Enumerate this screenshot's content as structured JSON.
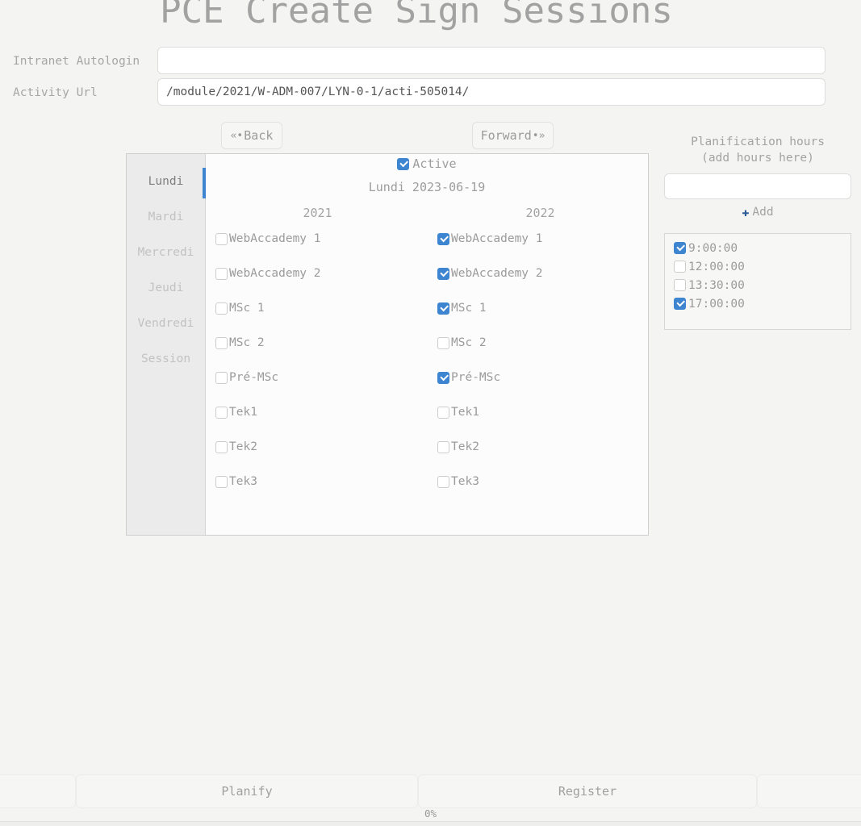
{
  "header": {
    "title": "PCE Create Sign Sessions"
  },
  "form": {
    "fields": [
      {
        "label": "Intranet Autologin",
        "value": "",
        "placeholder": ""
      },
      {
        "label": "Activity Url",
        "value": "/module/2021/W-ADM-007/LYN-0-1/acti-505014/",
        "placeholder": ""
      }
    ]
  },
  "nav": {
    "back_label": "Back",
    "back_icon": "rewind-icon",
    "back_glyph": "«•",
    "forward_label": "Forward",
    "forward_icon": "fast-forward-icon",
    "forward_glyph": "•»"
  },
  "tabs": {
    "items": [
      {
        "label": "Lundi",
        "active": true
      },
      {
        "label": "Mardi",
        "active": false
      },
      {
        "label": "Mercredi",
        "active": false
      },
      {
        "label": "Jeudi",
        "active": false
      },
      {
        "label": "Vendredi",
        "active": false
      },
      {
        "label": "Session",
        "active": false
      }
    ],
    "active_indicator_color": "#3d85d0"
  },
  "panel": {
    "active_checkbox": {
      "label": "Active",
      "checked": true
    },
    "date_label": "Lundi 2023-06-19",
    "columns": [
      {
        "header": "2021"
      },
      {
        "header": "2022"
      }
    ],
    "rows": [
      {
        "col1": {
          "label": "WebAccademy 1",
          "checked": false
        },
        "col2": {
          "label": "WebAccademy 1",
          "checked": true
        }
      },
      {
        "col1": {
          "label": "WebAccademy 2",
          "checked": false
        },
        "col2": {
          "label": "WebAccademy 2",
          "checked": true
        }
      },
      {
        "col1": {
          "label": "MSc 1",
          "checked": false
        },
        "col2": {
          "label": "MSc 1",
          "checked": true
        }
      },
      {
        "col1": {
          "label": "MSc 2",
          "checked": false
        },
        "col2": {
          "label": "MSc 2",
          "checked": false
        }
      },
      {
        "col1": {
          "label": "Pré-MSc",
          "checked": false
        },
        "col2": {
          "label": "Pré-MSc",
          "checked": true
        }
      },
      {
        "col1": {
          "label": "Tek1",
          "checked": false
        },
        "col2": {
          "label": "Tek1",
          "checked": false
        }
      },
      {
        "col1": {
          "label": "Tek2",
          "checked": false
        },
        "col2": {
          "label": "Tek2",
          "checked": false
        }
      },
      {
        "col1": {
          "label": "Tek3",
          "checked": false
        },
        "col2": {
          "label": "Tek3",
          "checked": false
        }
      }
    ]
  },
  "hours": {
    "title_line1": "Planification hours",
    "title_line2": "(add hours here)",
    "input_value": "",
    "input_placeholder": "",
    "add_label": "Add",
    "add_icon": "plus-icon",
    "add_glyph": "✚",
    "items": [
      {
        "label": "9:00:00",
        "checked": true
      },
      {
        "label": "12:00:00",
        "checked": false
      },
      {
        "label": "13:30:00",
        "checked": false
      },
      {
        "label": "17:00:00",
        "checked": true
      }
    ]
  },
  "footer": {
    "buttons": [
      {
        "label": ""
      },
      {
        "label": "Planify"
      },
      {
        "label": "Register"
      },
      {
        "label": ""
      }
    ],
    "progress_label": "0%",
    "progress_percent": 0,
    "progress_color": "#3d85d0"
  }
}
